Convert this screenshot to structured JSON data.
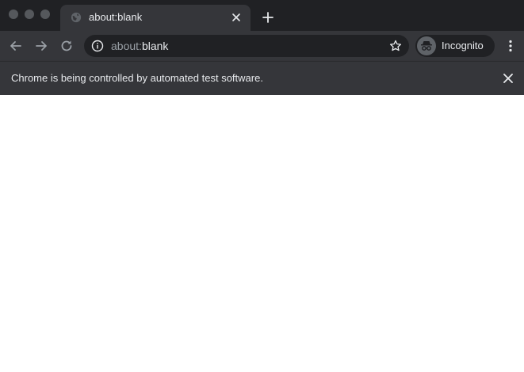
{
  "tab": {
    "title": "about:blank",
    "favicon_icon": "globe-icon",
    "close_icon": "close-icon"
  },
  "new_tab_icon": "plus-icon",
  "toolbar": {
    "back_icon": "arrow-left-icon",
    "forward_icon": "arrow-right-icon",
    "reload_icon": "reload-icon",
    "menu_icon": "kebab-menu-icon"
  },
  "omnibox": {
    "security_icon": "info-icon",
    "url_scheme": "about:",
    "url_host": "blank",
    "bookmark_icon": "star-icon"
  },
  "profile": {
    "label": "Incognito",
    "icon": "incognito-icon"
  },
  "infobar": {
    "message": "Chrome is being controlled by automated test software.",
    "close_icon": "close-icon"
  },
  "colors": {
    "tabstrip_bg": "#202124",
    "toolbar_bg": "#35363a",
    "text": "#e8eaed",
    "muted_text": "#9aa0a6",
    "page_bg": "#ffffff"
  }
}
